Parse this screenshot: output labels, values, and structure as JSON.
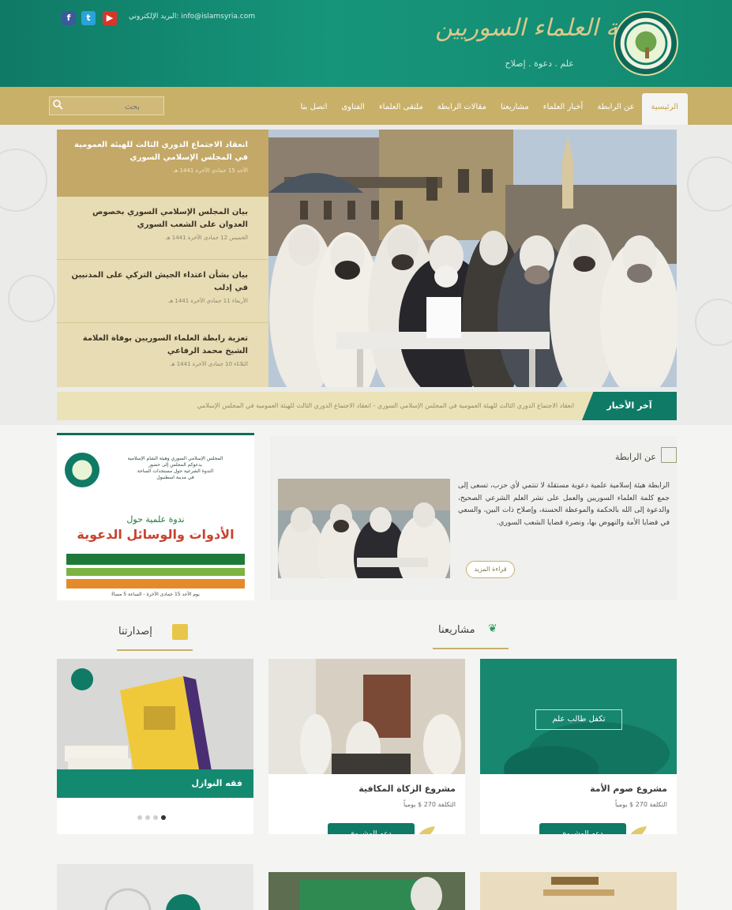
{
  "header": {
    "site_title": "رابطة العلماء السوريين",
    "tagline": "علم . دعوة . إصلاح",
    "contact_email": "البريد الإلكتروني: info@islamsyria.com",
    "social": {
      "facebook": "f",
      "twitter": "t",
      "youtube": "▶"
    }
  },
  "nav": {
    "items": [
      "الرئيسية",
      "عن الرابطة",
      "أخبار العلماء",
      "مشاريعنا",
      "مقالات الرابطة",
      "ملتقى العلماء",
      "الفتاوى",
      "اتصل بنا"
    ],
    "active_index": 0,
    "search_placeholder": "بحث"
  },
  "slider": {
    "news": [
      {
        "title": "انعقاد الاجتماع الدوري الثالث للهيئة العمومية في المجلس الإسلامي السوري",
        "date": "الأحد 15 جمادى الآخرة 1441 هـ"
      },
      {
        "title": "بيان المجلس الإسلامي السوري بخصوص العدوان على الشعب السوري",
        "date": "الخميس 12 جمادى الآخرة 1441 هـ"
      },
      {
        "title": "بيان بشأن اعتداء الجيش التركي على المدنيين في إدلب",
        "date": "الأربعاء 11 جمادى الآخرة 1441 هـ"
      },
      {
        "title": "تعزية رابطة العلماء السوريين بوفاة العلامة الشيخ محمد الرفاعي",
        "date": "الثلاثاء 10 جمادى الآخرة 1441 هـ"
      }
    ]
  },
  "ticker": {
    "label": "آخر الأخبار",
    "text": "انعقاد الاجتماع الدوري الثالث للهيئة العمومية في المجلس الإسلامي السوري - انعقاد الاجتماع الدوري الثالث للهيئة العمومية في المجلس الإسلامي"
  },
  "about": {
    "title": "عن الرابطة",
    "text": "الرابطة هيئة إسلامية علمية دعوية مستقلة لا تنتمي لأي حزب، تسعى إلى جمع كلمة العلماء السوريين والعمل على نشر العلم الشرعي الصحيح، والدعوة إلى الله بالحكمة والموعظة الحسنة، وإصلاح ذات البين، والسعي في قضايا الأمة والنهوض بها، ونصرة قضايا الشعب السوري.",
    "more_label": "قراءة المزيد"
  },
  "flyer": {
    "lines": [
      "المجلس الإسلامي السوري وهيئة الشام الإسلامية",
      "يدعوكم المجلس إلى حضور",
      "الندوة الشرعية حول مستجدات الساحة",
      "في مدينة اسطنبول"
    ],
    "head1": "ندوة علمية حول",
    "head2": "الأدوات والوسائل الدعوية",
    "footer": "يوم الأحد 15 جمادى الآخرة - الساعة 5 مساءً"
  },
  "projects": {
    "heading": "مشاريعنا",
    "items": [
      {
        "title": "مشروع صوم الأمة",
        "amount": "التكلفة 270 $ يومياً",
        "button": "دعم المشروع",
        "overlay": "تكفل طالب علم"
      },
      {
        "title": "مشروع الزكاة المكافية",
        "amount": "التكلفة 270 $ يومياً",
        "button": "دعم المشروع"
      }
    ]
  },
  "publications": {
    "heading": "إصدارتنا",
    "caption": "فقه النوازل",
    "dots": 4,
    "active_dot": 3
  },
  "colors": {
    "primary_green": "#0f7a66",
    "gold": "#c9b068",
    "beige": "#e7dcb4"
  }
}
